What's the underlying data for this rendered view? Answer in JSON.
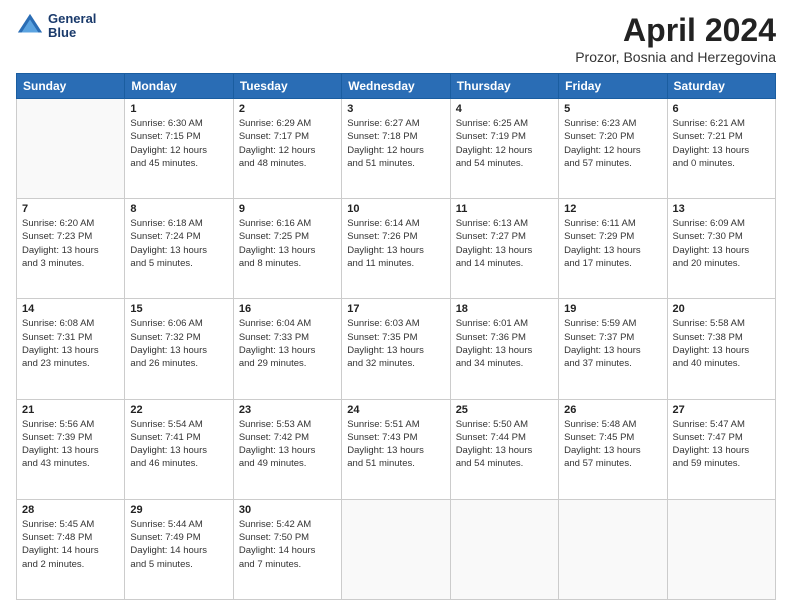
{
  "logo": {
    "line1": "General",
    "line2": "Blue"
  },
  "title": "April 2024",
  "subtitle": "Prozor, Bosnia and Herzegovina",
  "days_of_week": [
    "Sunday",
    "Monday",
    "Tuesday",
    "Wednesday",
    "Thursday",
    "Friday",
    "Saturday"
  ],
  "weeks": [
    [
      {
        "day": "",
        "info": ""
      },
      {
        "day": "1",
        "info": "Sunrise: 6:30 AM\nSunset: 7:15 PM\nDaylight: 12 hours\nand 45 minutes."
      },
      {
        "day": "2",
        "info": "Sunrise: 6:29 AM\nSunset: 7:17 PM\nDaylight: 12 hours\nand 48 minutes."
      },
      {
        "day": "3",
        "info": "Sunrise: 6:27 AM\nSunset: 7:18 PM\nDaylight: 12 hours\nand 51 minutes."
      },
      {
        "day": "4",
        "info": "Sunrise: 6:25 AM\nSunset: 7:19 PM\nDaylight: 12 hours\nand 54 minutes."
      },
      {
        "day": "5",
        "info": "Sunrise: 6:23 AM\nSunset: 7:20 PM\nDaylight: 12 hours\nand 57 minutes."
      },
      {
        "day": "6",
        "info": "Sunrise: 6:21 AM\nSunset: 7:21 PM\nDaylight: 13 hours\nand 0 minutes."
      }
    ],
    [
      {
        "day": "7",
        "info": "Sunrise: 6:20 AM\nSunset: 7:23 PM\nDaylight: 13 hours\nand 3 minutes."
      },
      {
        "day": "8",
        "info": "Sunrise: 6:18 AM\nSunset: 7:24 PM\nDaylight: 13 hours\nand 5 minutes."
      },
      {
        "day": "9",
        "info": "Sunrise: 6:16 AM\nSunset: 7:25 PM\nDaylight: 13 hours\nand 8 minutes."
      },
      {
        "day": "10",
        "info": "Sunrise: 6:14 AM\nSunset: 7:26 PM\nDaylight: 13 hours\nand 11 minutes."
      },
      {
        "day": "11",
        "info": "Sunrise: 6:13 AM\nSunset: 7:27 PM\nDaylight: 13 hours\nand 14 minutes."
      },
      {
        "day": "12",
        "info": "Sunrise: 6:11 AM\nSunset: 7:29 PM\nDaylight: 13 hours\nand 17 minutes."
      },
      {
        "day": "13",
        "info": "Sunrise: 6:09 AM\nSunset: 7:30 PM\nDaylight: 13 hours\nand 20 minutes."
      }
    ],
    [
      {
        "day": "14",
        "info": "Sunrise: 6:08 AM\nSunset: 7:31 PM\nDaylight: 13 hours\nand 23 minutes."
      },
      {
        "day": "15",
        "info": "Sunrise: 6:06 AM\nSunset: 7:32 PM\nDaylight: 13 hours\nand 26 minutes."
      },
      {
        "day": "16",
        "info": "Sunrise: 6:04 AM\nSunset: 7:33 PM\nDaylight: 13 hours\nand 29 minutes."
      },
      {
        "day": "17",
        "info": "Sunrise: 6:03 AM\nSunset: 7:35 PM\nDaylight: 13 hours\nand 32 minutes."
      },
      {
        "day": "18",
        "info": "Sunrise: 6:01 AM\nSunset: 7:36 PM\nDaylight: 13 hours\nand 34 minutes."
      },
      {
        "day": "19",
        "info": "Sunrise: 5:59 AM\nSunset: 7:37 PM\nDaylight: 13 hours\nand 37 minutes."
      },
      {
        "day": "20",
        "info": "Sunrise: 5:58 AM\nSunset: 7:38 PM\nDaylight: 13 hours\nand 40 minutes."
      }
    ],
    [
      {
        "day": "21",
        "info": "Sunrise: 5:56 AM\nSunset: 7:39 PM\nDaylight: 13 hours\nand 43 minutes."
      },
      {
        "day": "22",
        "info": "Sunrise: 5:54 AM\nSunset: 7:41 PM\nDaylight: 13 hours\nand 46 minutes."
      },
      {
        "day": "23",
        "info": "Sunrise: 5:53 AM\nSunset: 7:42 PM\nDaylight: 13 hours\nand 49 minutes."
      },
      {
        "day": "24",
        "info": "Sunrise: 5:51 AM\nSunset: 7:43 PM\nDaylight: 13 hours\nand 51 minutes."
      },
      {
        "day": "25",
        "info": "Sunrise: 5:50 AM\nSunset: 7:44 PM\nDaylight: 13 hours\nand 54 minutes."
      },
      {
        "day": "26",
        "info": "Sunrise: 5:48 AM\nSunset: 7:45 PM\nDaylight: 13 hours\nand 57 minutes."
      },
      {
        "day": "27",
        "info": "Sunrise: 5:47 AM\nSunset: 7:47 PM\nDaylight: 13 hours\nand 59 minutes."
      }
    ],
    [
      {
        "day": "28",
        "info": "Sunrise: 5:45 AM\nSunset: 7:48 PM\nDaylight: 14 hours\nand 2 minutes."
      },
      {
        "day": "29",
        "info": "Sunrise: 5:44 AM\nSunset: 7:49 PM\nDaylight: 14 hours\nand 5 minutes."
      },
      {
        "day": "30",
        "info": "Sunrise: 5:42 AM\nSunset: 7:50 PM\nDaylight: 14 hours\nand 7 minutes."
      },
      {
        "day": "",
        "info": ""
      },
      {
        "day": "",
        "info": ""
      },
      {
        "day": "",
        "info": ""
      },
      {
        "day": "",
        "info": ""
      }
    ]
  ]
}
